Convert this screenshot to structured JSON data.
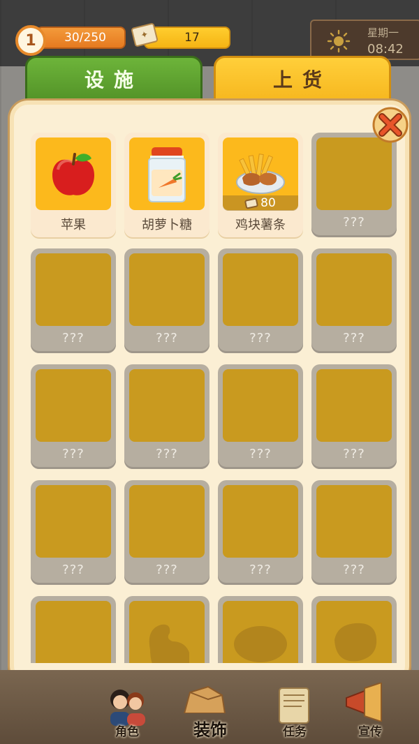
{
  "hud": {
    "level": "1",
    "xp": "30/250",
    "tickets": "17",
    "weekday": "星期一",
    "time": "08:42"
  },
  "tabs": [
    {
      "label": "设施",
      "active": false
    },
    {
      "label": "上货",
      "active": true
    }
  ],
  "items": [
    {
      "name": "苹果",
      "unlocked": true,
      "icon": "apple-icon"
    },
    {
      "name": "胡萝卜糖",
      "unlocked": true,
      "icon": "carrot-candy-jar-icon"
    },
    {
      "name": "鸡块薯条",
      "unlocked": false,
      "icon": "chicken-fries-plate-icon",
      "price": "80"
    },
    {
      "name": "???",
      "unlocked": false
    },
    {
      "name": "???",
      "unlocked": false
    },
    {
      "name": "???",
      "unlocked": false
    },
    {
      "name": "???",
      "unlocked": false
    },
    {
      "name": "???",
      "unlocked": false
    },
    {
      "name": "???",
      "unlocked": false
    },
    {
      "name": "???",
      "unlocked": false
    },
    {
      "name": "???",
      "unlocked": false
    },
    {
      "name": "???",
      "unlocked": false
    },
    {
      "name": "???",
      "unlocked": false
    },
    {
      "name": "???",
      "unlocked": false
    },
    {
      "name": "???",
      "unlocked": false
    },
    {
      "name": "???",
      "unlocked": false
    }
  ],
  "bottom_nav": [
    {
      "label": "角色",
      "icon": "characters-icon"
    },
    {
      "label": "装饰",
      "icon": "decor-icon"
    },
    {
      "label": "任务",
      "icon": "scroll-icon"
    },
    {
      "label": "宣传",
      "icon": "megaphone-icon"
    }
  ],
  "colors": {
    "tab_green": "#5fa22f",
    "tab_yellow": "#f9c12a",
    "slot_gold": "#c99a1f",
    "panel_cream": "#fbefd4"
  }
}
